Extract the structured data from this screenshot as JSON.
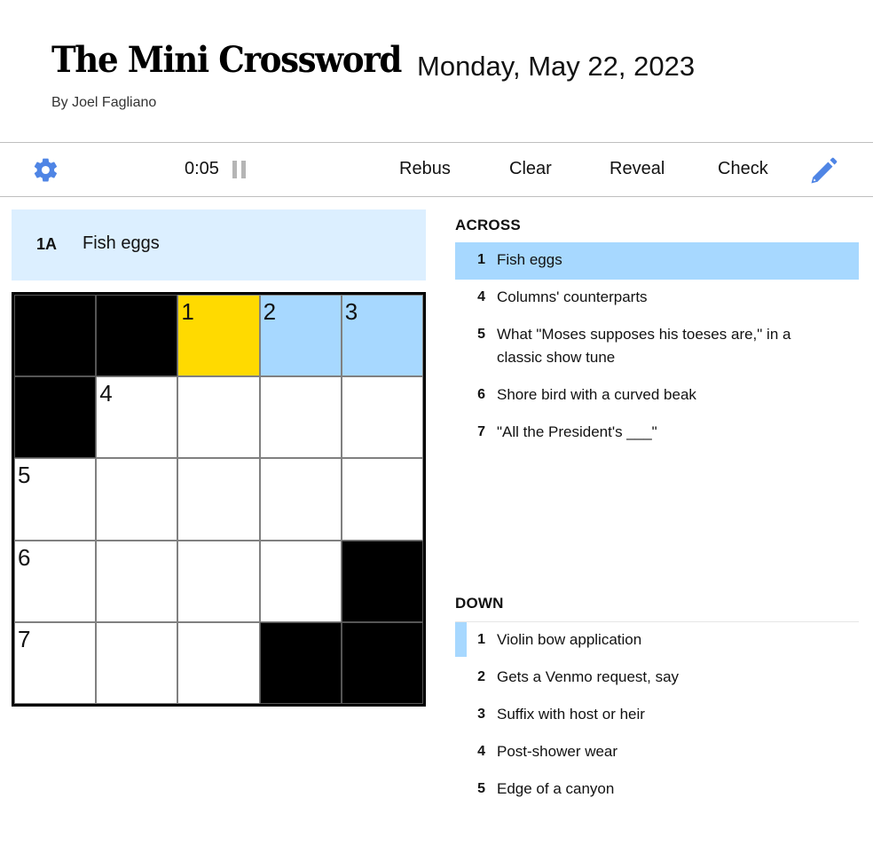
{
  "header": {
    "title": "The Mini Crossword",
    "date": "Monday, May 22, 2023",
    "byline": "By Joel Fagliano"
  },
  "toolbar": {
    "settings_icon": "gear-icon",
    "timer": "0:05",
    "pause_icon": "pause-icon",
    "rebus_label": "Rebus",
    "clear_label": "Clear",
    "reveal_label": "Reveal",
    "check_label": "Check",
    "pencil_icon": "pencil-icon"
  },
  "current_clue": {
    "label": "1A",
    "text": "Fish eggs"
  },
  "colors": {
    "active_cell": "#ffda00",
    "word_highlight": "#a7d8ff",
    "clue_bar": "#dcefff",
    "icon_blue": "#4f85e5"
  },
  "grid": {
    "rows": [
      [
        {
          "block": true
        },
        {
          "block": true
        },
        {
          "number": "1",
          "state": "active"
        },
        {
          "number": "2",
          "state": "word"
        },
        {
          "number": "3",
          "state": "word"
        }
      ],
      [
        {
          "block": true
        },
        {
          "number": "4"
        },
        {},
        {},
        {}
      ],
      [
        {
          "number": "5"
        },
        {},
        {},
        {},
        {}
      ],
      [
        {
          "number": "6"
        },
        {},
        {},
        {},
        {
          "block": true
        }
      ],
      [
        {
          "number": "7"
        },
        {},
        {},
        {
          "block": true
        },
        {
          "block": true
        }
      ]
    ]
  },
  "clues": {
    "across_title": "ACROSS",
    "across": [
      {
        "num": "1",
        "text": "Fish eggs",
        "state": "selected"
      },
      {
        "num": "4",
        "text": "Columns' counterparts"
      },
      {
        "num": "5",
        "text": "What \"Moses supposes his toeses are,\" in a classic show tune"
      },
      {
        "num": "6",
        "text": "Shore bird with a curved beak"
      },
      {
        "num": "7",
        "text": "\"All the President's ___\""
      }
    ],
    "down_title": "DOWN",
    "down": [
      {
        "num": "1",
        "text": "Violin bow application",
        "state": "related"
      },
      {
        "num": "2",
        "text": "Gets a Venmo request, say"
      },
      {
        "num": "3",
        "text": "Suffix with host or heir"
      },
      {
        "num": "4",
        "text": "Post-shower wear"
      },
      {
        "num": "5",
        "text": "Edge of a canyon"
      }
    ]
  }
}
